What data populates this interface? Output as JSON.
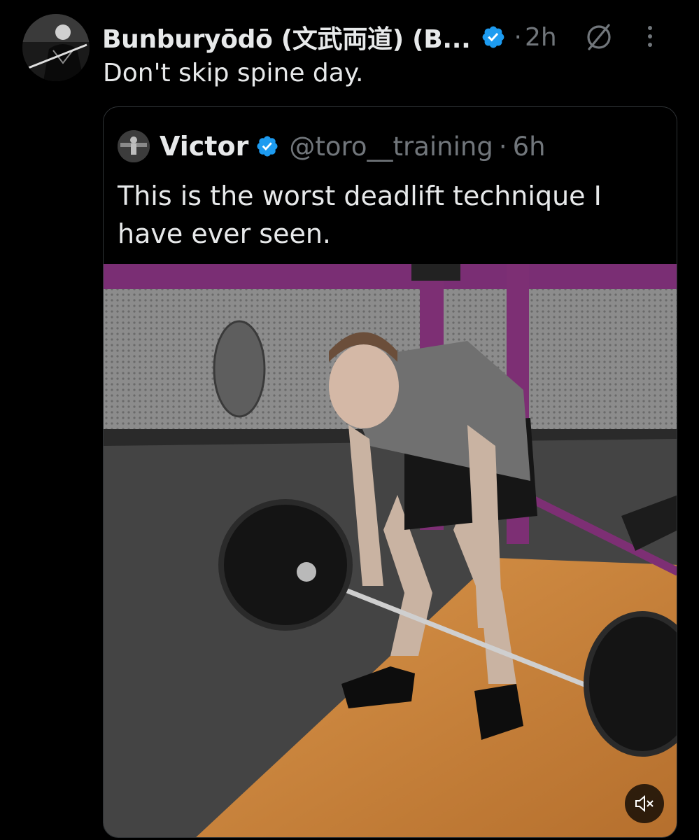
{
  "post": {
    "author_name": "Bunburyōdō (文武両道) (B...",
    "time": "2h",
    "separator": "·",
    "text": "Don't skip spine day.",
    "icons": {
      "avatar": "samurai-avatar",
      "verified": "verified-badge-icon",
      "grok": "grok-icon",
      "more": "more-options-icon"
    }
  },
  "quote": {
    "name": "Victor",
    "handle": "@toro__training",
    "separator": "·",
    "time": "6h",
    "text": "This is the worst deadlift technique I have ever seen.",
    "media": {
      "kind": "video",
      "muted": true,
      "icon": "speaker-muted-icon"
    }
  },
  "colors": {
    "background": "#000000",
    "text_primary": "#e7e9ea",
    "text_secondary": "#71767b",
    "verified_blue": "#1d9bf0",
    "border": "#2f3336"
  }
}
